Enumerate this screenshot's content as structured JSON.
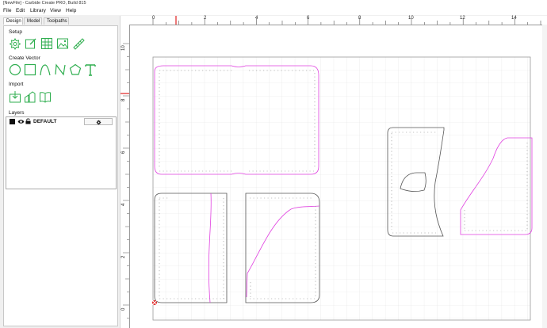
{
  "window": {
    "title": "[NewFile] - Carbide Create PRO, Build 815"
  },
  "menu": [
    "File",
    "Edit",
    "Library",
    "View",
    "Help"
  ],
  "tabs": [
    "Design",
    "Model",
    "Toolpaths"
  ],
  "sections": {
    "setup": "Setup",
    "create_vector": "Create Vector",
    "import": "Import",
    "layers": "Layers"
  },
  "setup_tools": [
    "job-setup-icon",
    "edit-icon",
    "grid-icon",
    "image-icon",
    "measure-icon"
  ],
  "vector_tools": [
    "circle-icon",
    "rectangle-icon",
    "curve-icon",
    "polyline-icon",
    "polygon-icon",
    "text-icon"
  ],
  "import_tools": [
    "import-icon",
    "trace-icon",
    "library-icon"
  ],
  "layer": {
    "name": "DEFAULT"
  },
  "ruler": {
    "x_labels": [
      "0",
      "2",
      "4",
      "6",
      "8",
      "10",
      "12",
      "14"
    ],
    "y_labels": [
      "10",
      "8",
      "6",
      "4",
      "2",
      "0"
    ]
  },
  "colors": {
    "accent_green": "#2fae4f",
    "magenta": "#e040e0",
    "grid": "#dcdcdc",
    "stitch": "#808080"
  }
}
